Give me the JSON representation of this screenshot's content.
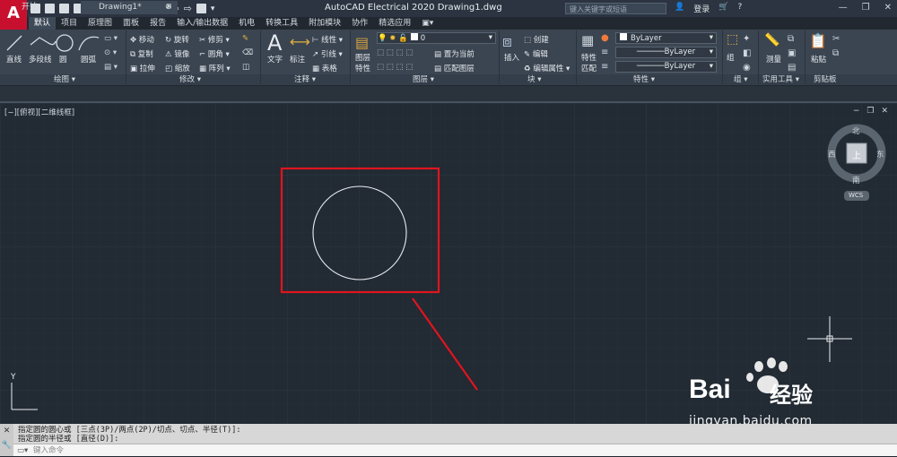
{
  "app": {
    "title": "AutoCAD Electrical 2020    Drawing1.dwg",
    "search_placeholder": "键入关键字或短语",
    "login_label": "登录",
    "window_controls": [
      "—",
      "❐",
      "✕"
    ]
  },
  "ribbon_tabs": [
    "默认",
    "项目",
    "原理图",
    "面板",
    "报告",
    "输入/输出数据",
    "机电",
    "转换工具",
    "附加模块",
    "协作",
    "精选应用"
  ],
  "active_tab_index": 0,
  "ribbon_panels": {
    "draw": {
      "title": "绘图 ▾",
      "items": [
        "直线",
        "多段线",
        "圆",
        "圆弧"
      ]
    },
    "modify": {
      "title": "修改 ▾",
      "items": [
        "移动",
        "旋转",
        "修剪 ▾",
        "复制",
        "镜像",
        "圆角 ▾",
        "拉伸",
        "缩放",
        "阵列 ▾"
      ]
    },
    "annotation": {
      "title": "注释 ▾",
      "items": [
        "文字",
        "标注",
        "线性 ▾",
        "引线 ▾",
        "表格"
      ]
    },
    "layers": {
      "title": "图层 ▾",
      "items": [
        "图层",
        "特性",
        "置为当前",
        "匹配图层"
      ],
      "current_layer": "0"
    },
    "block": {
      "title": "块 ▾",
      "items": [
        "插入",
        "创建",
        "编辑",
        "编辑属性 ▾"
      ]
    },
    "properties": {
      "title": "特性 ▾",
      "items": [
        "特性",
        "匹配"
      ],
      "color": "ByLayer",
      "linetype": "ByLayer",
      "lineweight": "ByLayer"
    },
    "groups": {
      "title": "组 ▾",
      "items": [
        "组"
      ]
    },
    "utilities": {
      "title": "实用工具 ▾",
      "items": [
        "测量"
      ]
    },
    "clipboard": {
      "title": "剪贴板",
      "items": [
        "粘贴"
      ]
    }
  },
  "file_tabs": [
    "开始",
    "Drawing1*"
  ],
  "viewport": {
    "label": "[−][俯视][二维线框]",
    "viewcube": {
      "north": "北",
      "south": "南",
      "east": "东",
      "west": "西",
      "top": "上",
      "wcs": "WCS"
    },
    "ucs_y": "Y"
  },
  "command": {
    "history": [
      "指定圆的圆心或 [三点(3P)/两点(2P)/切点、切点、半径(T)]:",
      "指定圆的半径或 [直径(D)]:"
    ],
    "input_placeholder": "键入命令"
  },
  "watermark": {
    "brand": "Bai",
    "site": "jingyan.baidu.com",
    "name": "经验"
  },
  "colors": {
    "canvas": "#222a33",
    "ribbon": "#3b4552",
    "highlight_box": "#e0141e",
    "circle": "#e9edf1"
  }
}
